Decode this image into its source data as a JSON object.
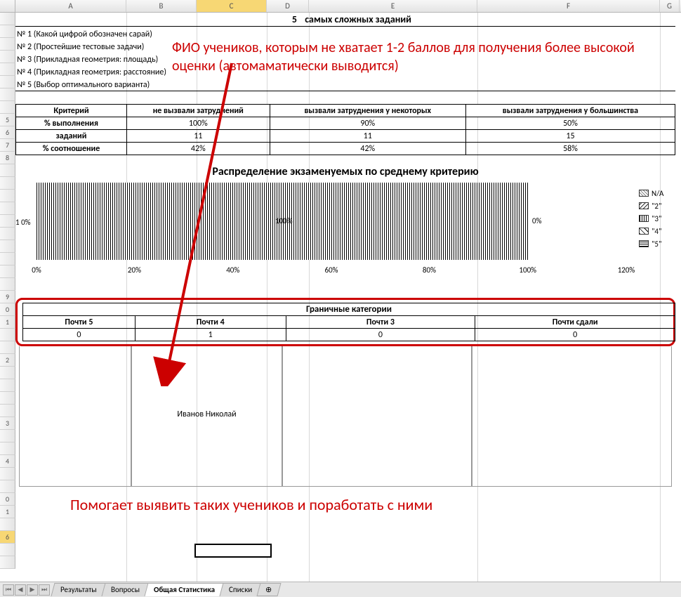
{
  "columns": [
    "A",
    "B",
    "C",
    "D",
    "E",
    "F",
    "G"
  ],
  "selected_column": "C",
  "title": {
    "num": "5",
    "text": "самых сложных заданий"
  },
  "tasks": [
    "№ 1 (Какой цифрой обозначен сарай)",
    "№ 2 (Простейшие тестовые задачи)",
    "№ 3 (Прикладная геометрия: площадь)",
    "№ 4 (Прикладная геометрия: расстояние)",
    "№ 5 (Выбор оптимального варианта)"
  ],
  "criteria": {
    "headers": [
      "Критерий",
      "не вызвали затруднений",
      "вызвали затруднения у некоторых",
      "вызвали затруднения у большинства"
    ],
    "rows": [
      {
        "label": "% выполнения",
        "vals": [
          "100%",
          "90%",
          "50%"
        ]
      },
      {
        "label": "заданий",
        "vals": [
          "11",
          "11",
          "15"
        ]
      },
      {
        "label": "% соотношение",
        "vals": [
          "42%",
          "42%",
          "58%"
        ]
      }
    ]
  },
  "chart_data": {
    "type": "bar",
    "title": "Распределение экзаменуемых по среднему критерию",
    "orientation": "horizontal-stacked",
    "categories": [
      "1"
    ],
    "series": [
      {
        "name": "N/A",
        "values": [
          0
        ]
      },
      {
        "name": "\"2\"",
        "values": [
          0
        ]
      },
      {
        "name": "\"3\"",
        "values": [
          100
        ]
      },
      {
        "name": "\"4\"",
        "values": [
          0
        ]
      },
      {
        "name": "\"5\"",
        "values": [
          0
        ]
      }
    ],
    "data_labels": [
      "0%",
      "100%",
      "0%"
    ],
    "xlabel": "",
    "ylabel": "1",
    "xlim": [
      0,
      120
    ],
    "x_ticks": [
      "0%",
      "20%",
      "40%",
      "60%",
      "80%",
      "100%",
      "120%"
    ],
    "legend": [
      "N/A",
      "\"2\"",
      "\"3\"",
      "\"4\"",
      "\"5\""
    ]
  },
  "boundary": {
    "title": "Граничные категории",
    "headers": [
      "Почти 5",
      "Почти 4",
      "Почти 3",
      "Почти сдали"
    ],
    "values": [
      "0",
      "1",
      "0",
      "0"
    ],
    "students": [
      "",
      "Иванов Николай",
      "",
      ""
    ]
  },
  "annotations": {
    "top": "ФИО учеников, которым не хватает 1-2 баллов для получения более высокой оценки (автомаматически выводится)",
    "bottom": "Помогает выявить таких учеников и поработать с ними"
  },
  "tabs": {
    "items": [
      "Результаты",
      "Вопросы",
      "Общая Статистика",
      "Списки"
    ],
    "active": 2
  },
  "row_numbers_visible": 28,
  "selected_row": 6
}
